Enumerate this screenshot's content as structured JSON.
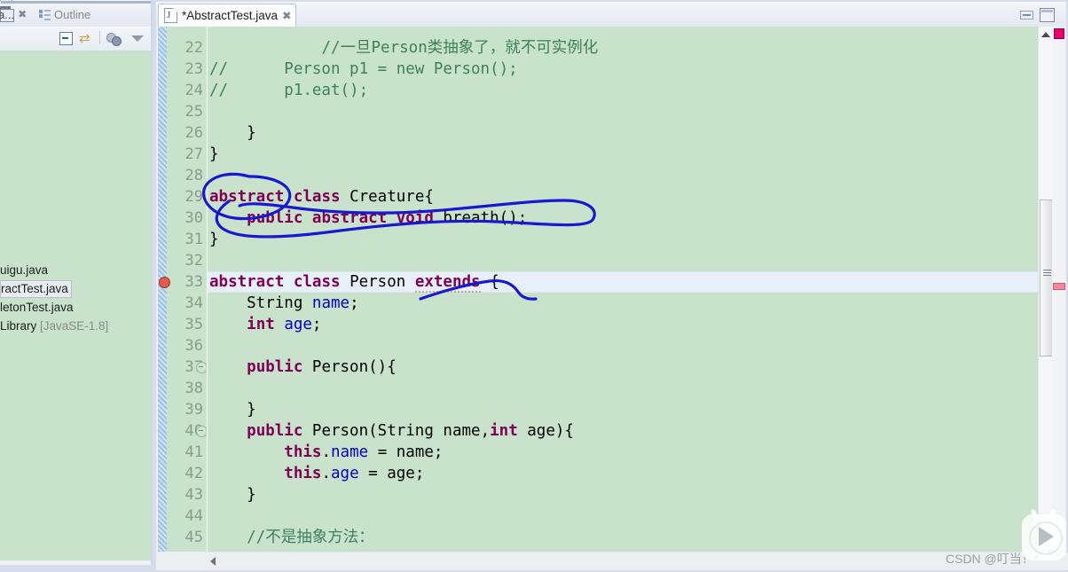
{
  "left_panel": {
    "tabs": [
      {
        "name": "truncated-tab",
        "label": "a...",
        "close": "✖"
      },
      {
        "name": "outline-tab",
        "label": "Outline"
      }
    ],
    "toolbar": {
      "collapse_all": "collapse-all-icon",
      "link_with_editor": "link-with-editor-icon",
      "filter": "filter-icon",
      "view_menu": "view-menu-icon"
    },
    "window_buttons": {
      "minimize": "minimize-icon",
      "maximize": "maximize-icon"
    },
    "tree_items": [
      {
        "label": "uigu.java",
        "selected": false,
        "meta": ""
      },
      {
        "label": "ractTest.java",
        "selected": true,
        "meta": ""
      },
      {
        "label": "letonTest.java",
        "selected": false,
        "meta": ""
      },
      {
        "label": " Library ",
        "selected": false,
        "meta": "[JavaSE-1.8]"
      }
    ]
  },
  "editor": {
    "tab": {
      "label": "*AbstractTest.java",
      "close": "✖",
      "icon": "java-file-icon"
    },
    "window_buttons": {
      "minimize": "minimize-icon",
      "maximize": "maximize-icon"
    },
    "current_line": 33,
    "error_line": 33,
    "colors": {
      "background": "#c9e2cb",
      "keyword": "#7f0055",
      "field": "#0000c0",
      "comment": "#3f7f5f",
      "line_number": "#8b9a8d",
      "current_line_highlight": "#e7eff9",
      "annotation_ink": "#1818d0",
      "error_marker": "#e05a4f"
    },
    "lines": [
      {
        "n": 22,
        "fold": false,
        "tokens": [
          {
            "t": "            ",
            "c": "plain"
          },
          {
            "t": "//一旦Person类抽象了，就不可实例化",
            "c": "cmt"
          }
        ]
      },
      {
        "n": 23,
        "fold": false,
        "tokens": [
          {
            "t": "//      Person p1 = new Person();",
            "c": "cmt"
          }
        ]
      },
      {
        "n": 24,
        "fold": false,
        "tokens": [
          {
            "t": "//      p1.eat();",
            "c": "cmt"
          }
        ]
      },
      {
        "n": 25,
        "fold": false,
        "tokens": []
      },
      {
        "n": 26,
        "fold": false,
        "tokens": [
          {
            "t": "    }",
            "c": "plain"
          }
        ]
      },
      {
        "n": 27,
        "fold": false,
        "tokens": [
          {
            "t": "}",
            "c": "plain"
          }
        ]
      },
      {
        "n": 28,
        "fold": false,
        "tokens": []
      },
      {
        "n": 29,
        "fold": false,
        "tokens": [
          {
            "t": "abstract",
            "c": "kw"
          },
          {
            "t": " ",
            "c": "plain"
          },
          {
            "t": "class",
            "c": "kw"
          },
          {
            "t": " Creature{",
            "c": "plain"
          }
        ]
      },
      {
        "n": 30,
        "fold": false,
        "tokens": [
          {
            "t": "    ",
            "c": "plain"
          },
          {
            "t": "public abstract void",
            "c": "kw"
          },
          {
            "t": " breath();",
            "c": "plain"
          }
        ]
      },
      {
        "n": 31,
        "fold": false,
        "tokens": [
          {
            "t": "}",
            "c": "plain"
          }
        ]
      },
      {
        "n": 32,
        "fold": false,
        "tokens": []
      },
      {
        "n": 33,
        "fold": false,
        "tokens": [
          {
            "t": "abstract",
            "c": "kw"
          },
          {
            "t": " ",
            "c": "plain"
          },
          {
            "t": "class",
            "c": "kw"
          },
          {
            "t": " Person ",
            "c": "plain"
          },
          {
            "t": "extends",
            "c": "kw-err"
          },
          {
            "t": " {",
            "c": "plain"
          }
        ]
      },
      {
        "n": 34,
        "fold": false,
        "tokens": [
          {
            "t": "    String ",
            "c": "plain"
          },
          {
            "t": "name",
            "c": "fld"
          },
          {
            "t": ";",
            "c": "plain"
          }
        ]
      },
      {
        "n": 35,
        "fold": false,
        "tokens": [
          {
            "t": "    ",
            "c": "plain"
          },
          {
            "t": "int",
            "c": "kw"
          },
          {
            "t": " ",
            "c": "plain"
          },
          {
            "t": "age",
            "c": "fld"
          },
          {
            "t": ";",
            "c": "plain"
          }
        ]
      },
      {
        "n": 36,
        "fold": false,
        "tokens": []
      },
      {
        "n": 37,
        "fold": true,
        "tokens": [
          {
            "t": "    ",
            "c": "plain"
          },
          {
            "t": "public",
            "c": "kw"
          },
          {
            "t": " Person(){",
            "c": "plain"
          }
        ]
      },
      {
        "n": 38,
        "fold": false,
        "tokens": []
      },
      {
        "n": 39,
        "fold": false,
        "tokens": [
          {
            "t": "    }",
            "c": "plain"
          }
        ]
      },
      {
        "n": 40,
        "fold": true,
        "tokens": [
          {
            "t": "    ",
            "c": "plain"
          },
          {
            "t": "public",
            "c": "kw"
          },
          {
            "t": " Person(String ",
            "c": "plain"
          },
          {
            "t": "name",
            "c": "plain"
          },
          {
            "t": ",",
            "c": "plain"
          },
          {
            "t": "int",
            "c": "kw"
          },
          {
            "t": " age){",
            "c": "plain"
          }
        ]
      },
      {
        "n": 41,
        "fold": false,
        "tokens": [
          {
            "t": "        ",
            "c": "plain"
          },
          {
            "t": "this",
            "c": "kw"
          },
          {
            "t": ".",
            "c": "plain"
          },
          {
            "t": "name",
            "c": "fld"
          },
          {
            "t": " = name;",
            "c": "plain"
          }
        ]
      },
      {
        "n": 42,
        "fold": false,
        "tokens": [
          {
            "t": "        ",
            "c": "plain"
          },
          {
            "t": "this",
            "c": "kw"
          },
          {
            "t": ".",
            "c": "plain"
          },
          {
            "t": "age",
            "c": "fld"
          },
          {
            "t": " = age;",
            "c": "plain"
          }
        ]
      },
      {
        "n": 43,
        "fold": false,
        "tokens": [
          {
            "t": "    }",
            "c": "plain"
          }
        ]
      },
      {
        "n": 44,
        "fold": false,
        "tokens": []
      },
      {
        "n": 45,
        "fold": false,
        "tokens": [
          {
            "t": "    ",
            "c": "plain"
          },
          {
            "t": "//不是抽象方法：",
            "c": "cmt"
          }
        ]
      }
    ]
  },
  "scrollbars": {
    "vertical": {
      "up_arrow": "scroll-up-icon",
      "thumb": "vertical-scroll-thumb"
    },
    "horizontal": {
      "left_arrow": "scroll-left-icon"
    },
    "markers": [
      {
        "name": "error-overview-marker-top",
        "color": "#e8006b"
      },
      {
        "name": "error-overview-marker",
        "color": "#f2859f"
      }
    ]
  },
  "watermark": {
    "text": "CSDN @叮当！*",
    "badge": "play-badge-icon"
  }
}
